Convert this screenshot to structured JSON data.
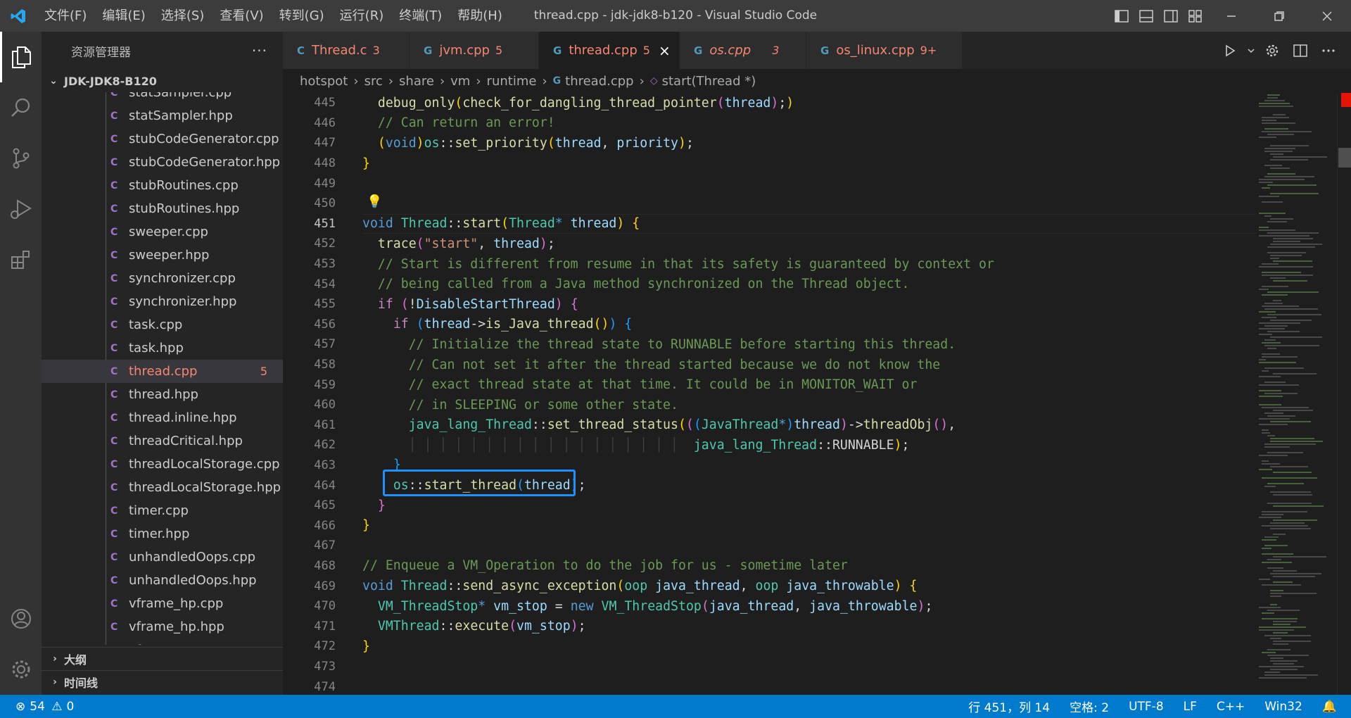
{
  "titlebar": {
    "menu": [
      "文件(F)",
      "编辑(E)",
      "选择(S)",
      "查看(V)",
      "转到(G)",
      "运行(R)",
      "终端(T)",
      "帮助(H)"
    ],
    "window_title": "thread.cpp - jdk-jdk8-b120 - Visual Studio Code",
    "brand_color": "#007acc"
  },
  "activitybar": {
    "items": [
      "explorer-icon",
      "search-icon",
      "source-control-icon",
      "run-debug-icon",
      "extensions-icon"
    ],
    "bottom": [
      "account-icon",
      "settings-gear-icon"
    ]
  },
  "sidebar": {
    "title": "资源管理器",
    "more": "···",
    "folder": "JDK-JDK8-B120",
    "files": [
      {
        "name": "statSampler.cpp",
        "badge": ""
      },
      {
        "name": "statSampler.hpp",
        "badge": ""
      },
      {
        "name": "stubCodeGenerator.cpp",
        "badge": ""
      },
      {
        "name": "stubCodeGenerator.hpp",
        "badge": ""
      },
      {
        "name": "stubRoutines.cpp",
        "badge": ""
      },
      {
        "name": "stubRoutines.hpp",
        "badge": ""
      },
      {
        "name": "sweeper.cpp",
        "badge": ""
      },
      {
        "name": "sweeper.hpp",
        "badge": ""
      },
      {
        "name": "synchronizer.cpp",
        "badge": ""
      },
      {
        "name": "synchronizer.hpp",
        "badge": ""
      },
      {
        "name": "task.cpp",
        "badge": ""
      },
      {
        "name": "task.hpp",
        "badge": ""
      },
      {
        "name": "thread.cpp",
        "badge": "5"
      },
      {
        "name": "thread.hpp",
        "badge": ""
      },
      {
        "name": "thread.inline.hpp",
        "badge": ""
      },
      {
        "name": "threadCritical.hpp",
        "badge": ""
      },
      {
        "name": "threadLocalStorage.cpp",
        "badge": ""
      },
      {
        "name": "threadLocalStorage.hpp",
        "badge": ""
      },
      {
        "name": "timer.cpp",
        "badge": ""
      },
      {
        "name": "timer.hpp",
        "badge": ""
      },
      {
        "name": "unhandledOops.cpp",
        "badge": ""
      },
      {
        "name": "unhandledOops.hpp",
        "badge": ""
      },
      {
        "name": "vframe_hp.cpp",
        "badge": ""
      },
      {
        "name": "vframe_hp.hpp",
        "badge": ""
      },
      {
        "name": "vframe.cpp",
        "badge": ""
      }
    ],
    "file_icon": "C",
    "sections": [
      "大纲",
      "时间线"
    ]
  },
  "tabs": [
    {
      "icon": "C",
      "label": "Thread.c",
      "count": "3"
    },
    {
      "icon": "G",
      "label": "jvm.cpp",
      "count": "5"
    },
    {
      "icon": "G",
      "label": "thread.cpp",
      "count": "5"
    },
    {
      "icon": "G",
      "label": "os.cpp",
      "count": "3"
    },
    {
      "icon": "G",
      "label": "os_linux.cpp",
      "count": "9+"
    }
  ],
  "breadcrumbs": [
    "hotspot",
    "src",
    "share",
    "vm",
    "runtime",
    "thread.cpp",
    "start(Thread *)"
  ],
  "editor": {
    "line_numbers": [
      "445",
      "446",
      "447",
      "448",
      "449",
      "450",
      "451",
      "452",
      "453",
      "454",
      "455",
      "456",
      "457",
      "458",
      "459",
      "460",
      "461",
      "462",
      "463",
      "464",
      "465",
      "466",
      "467",
      "468",
      "469",
      "470",
      "471",
      "472",
      "473",
      "474"
    ],
    "current_line": "451"
  },
  "statusbar": {
    "errors": "54",
    "warnings": "0",
    "position": "行 451，列 14",
    "spaces": "空格: 2",
    "encoding": "UTF-8",
    "eol": "LF",
    "language": "C++",
    "platform": "Win32"
  }
}
